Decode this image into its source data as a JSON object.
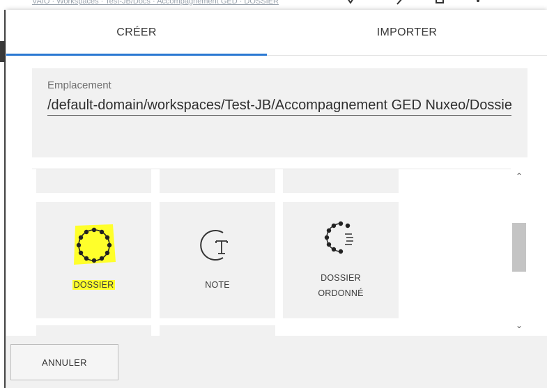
{
  "background": {
    "breadcrumb_text": "VAIO · Workspaces · Test-JB/Docs · Accompagnement GED · DOSSIER"
  },
  "tabs": [
    {
      "label": "CRÉER",
      "active": true
    },
    {
      "label": "IMPORTER",
      "active": false
    }
  ],
  "location": {
    "label": "Emplacement",
    "value": "/default-domain/workspaces/Test-JB/Accompagnement GED Nuxeo/Dossier"
  },
  "types": [
    {
      "label": "DOSSIER",
      "icon": "folder-dots-icon",
      "highlighted": true
    },
    {
      "label": "NOTE",
      "icon": "note-t-icon",
      "highlighted": false
    },
    {
      "label": "DOSSIER ORDONNÉ",
      "label_lines": [
        "DOSSIER",
        "ORDONNÉ"
      ],
      "icon": "ordered-folder-icon",
      "highlighted": false
    }
  ],
  "footer": {
    "cancel_label": "ANNULER"
  },
  "colors": {
    "tab_underline": "#2a78d2",
    "highlight": "#ffff2b",
    "tile_bg": "#f1f1f1"
  }
}
